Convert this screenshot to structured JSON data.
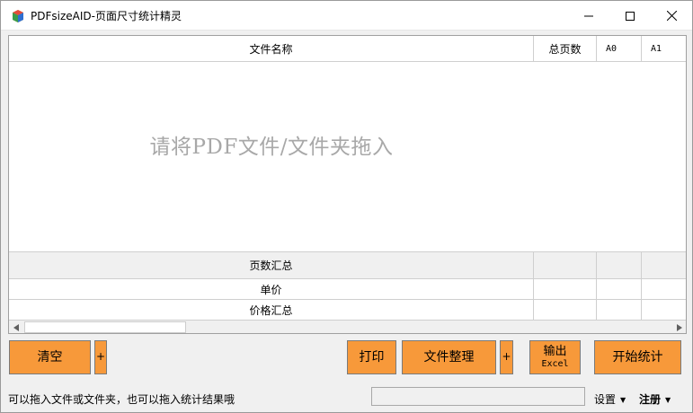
{
  "window": {
    "title": "PDFsizeAID-页面尺寸统计精灵",
    "controls": {
      "minimize": "minimize-icon",
      "maximize": "maximize-icon",
      "close": "close-icon"
    }
  },
  "table": {
    "columns": [
      "文件名称",
      "总页数",
      "A0",
      "A1"
    ],
    "drop_hint": "请将PDF文件/文件夹拖入",
    "summary_rows": [
      "页数汇总",
      "单价",
      "价格汇总"
    ]
  },
  "buttons": {
    "clear": "清空",
    "plus_clear": "+",
    "print": "打印",
    "organize": "文件整理",
    "plus_organize": "+",
    "export_line1": "输出",
    "export_line2": "Excel",
    "start": "开始统计"
  },
  "statusbar": {
    "message": "可以拖入文件或文件夹，也可以拖入统计结果哦",
    "settings": "设置",
    "register": "注册"
  },
  "colors": {
    "button_bg": "#f7993a",
    "hint_text": "#a8a8a8"
  }
}
